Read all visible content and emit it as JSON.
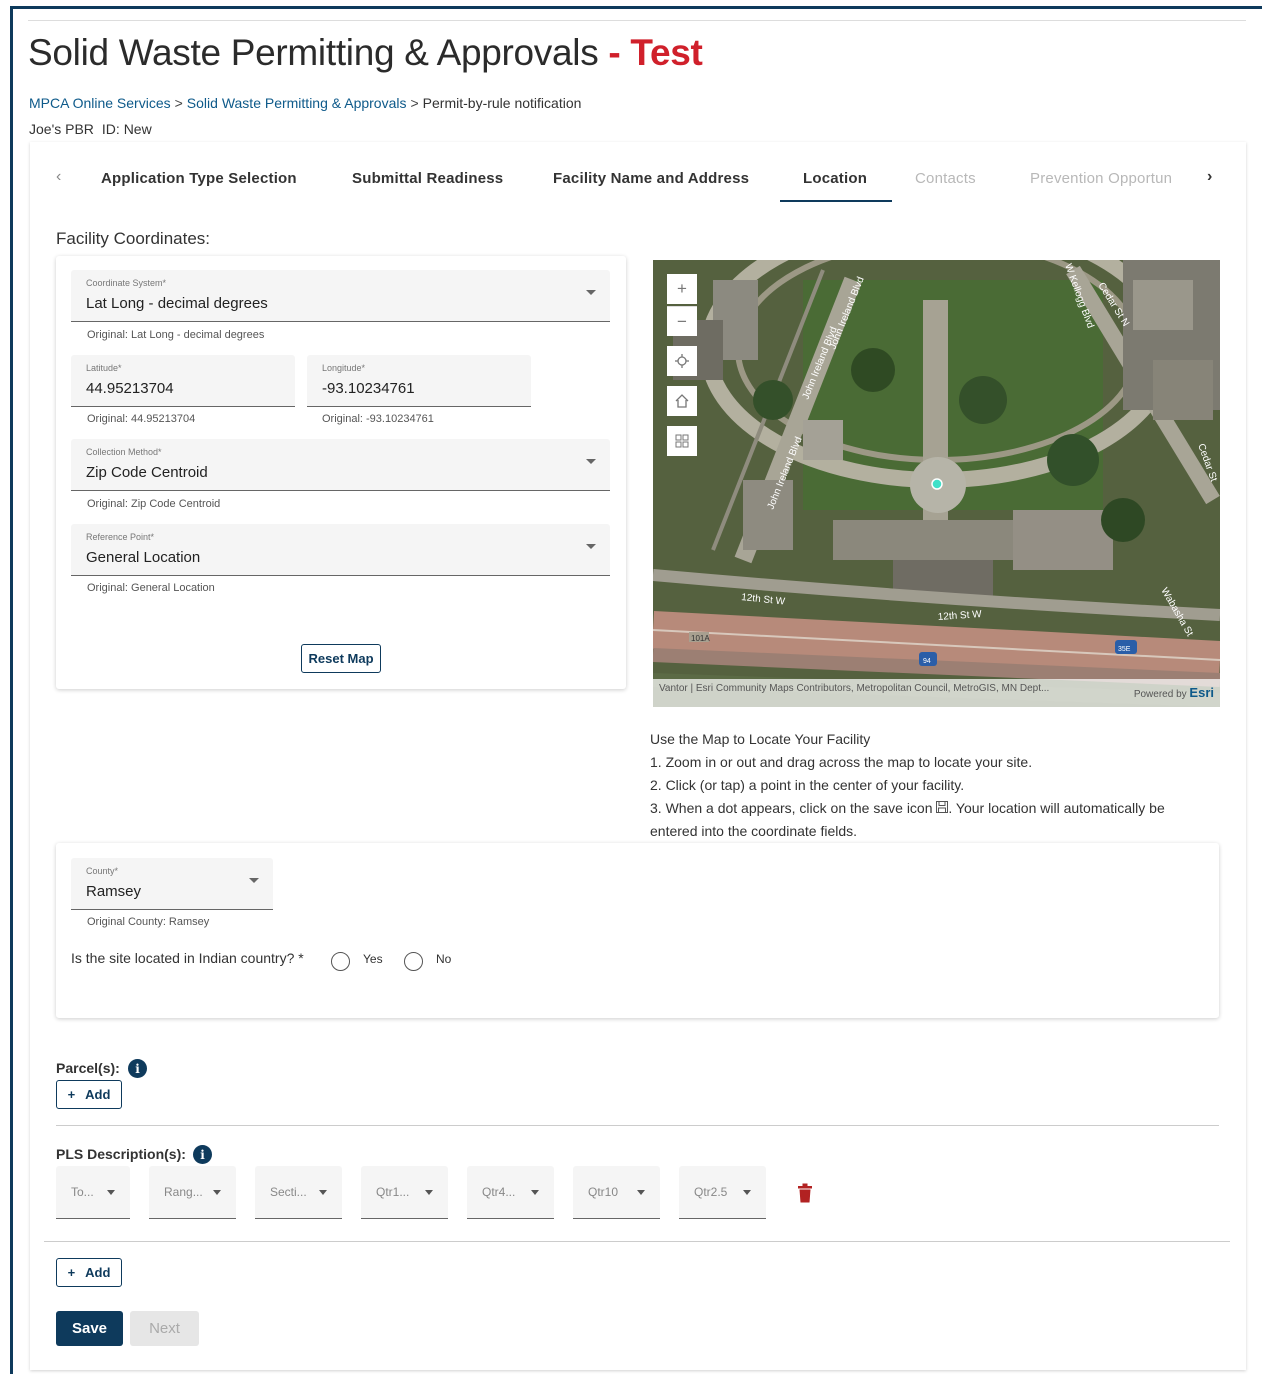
{
  "header": {
    "title": "Solid Waste Permitting & Approvals",
    "title_suffix": "- Test",
    "breadcrumb": [
      "MPCA Online Services",
      "Solid Waste Permitting & Approvals",
      "Permit-by-rule notification"
    ],
    "breadcrumb_sep": ">",
    "record_name": "Joe's PBR",
    "record_id": "ID: New"
  },
  "tabs": {
    "prev_icon": "chevron-left-icon",
    "next_icon": "chevron-right-icon",
    "items": [
      {
        "label": "Application Type Selection",
        "state": "enabled"
      },
      {
        "label": "Submittal Readiness",
        "state": "enabled"
      },
      {
        "label": "Facility Name and Address",
        "state": "enabled"
      },
      {
        "label": "Location",
        "state": "active"
      },
      {
        "label": "Contacts",
        "state": "disabled"
      },
      {
        "label": "Prevention Opportun",
        "state": "disabled"
      }
    ]
  },
  "coordinates": {
    "heading": "Facility Coordinates:",
    "coordinate_system": {
      "label": "Coordinate System*",
      "value": "Lat Long - decimal degrees",
      "original": "Original: Lat Long - decimal degrees"
    },
    "latitude": {
      "label": "Latitude*",
      "value": "44.95213704",
      "original": "Original: 44.95213704"
    },
    "longitude": {
      "label": "Longitude*",
      "value": "-93.10234761",
      "original": "Original: -93.10234761"
    },
    "collection_method": {
      "label": "Collection Method*",
      "value": "Zip Code Centroid",
      "original": "Original: Zip Code Centroid"
    },
    "reference_point": {
      "label": "Reference Point*",
      "value": "General Location",
      "original": "Original: General Location"
    },
    "reset_label": "Reset Map"
  },
  "map": {
    "controls": {
      "zoom_in": "+",
      "zoom_out": "−"
    },
    "street_labels": [
      "John Ireland Blvd",
      "John Ireland Blvd",
      "John Ireland Blvd",
      "12th St W",
      "12th St W",
      "Cedar St N",
      "Cedar St",
      "W Kellogg Blvd",
      "Wabasha St",
      "101A",
      "94",
      "35E"
    ],
    "attribution": "Vantor | Esri Community Maps Contributors, Metropolitan Council, MetroGIS, MN Dept...",
    "powered_by": "Powered by",
    "esri": "Esri",
    "colors": {
      "marker": "#3fe0c8",
      "highway": "#b78a7a"
    }
  },
  "instructions": {
    "title": "Use the Map to Locate Your Facility",
    "step1": "1. Zoom in or out and drag across the map to locate your site.",
    "step2": "2. Click (or tap) a point in the center of your facility.",
    "step3a": "3. When a dot appears, click on the save icon",
    "step3b": ". Your location will automatically be",
    "step3c": "entered into the coordinate fields."
  },
  "county": {
    "label": "County*",
    "value": "Ramsey",
    "original": "Original County: Ramsey",
    "indian_country_question": "Is the site located in Indian country? *",
    "yes": "Yes",
    "no": "No"
  },
  "parcels": {
    "label": "Parcel(s):",
    "add_label": "Add"
  },
  "pls": {
    "label": "PLS Description(s):",
    "fields": [
      "To...",
      "Rang...",
      "Secti...",
      "Qtr1...",
      "Qtr4...",
      "Qtr10",
      "Qtr2.5"
    ],
    "add_label": "Add"
  },
  "actions": {
    "save": "Save",
    "next": "Next"
  },
  "colors": {
    "brand": "#0e3a5c",
    "accent_red": "#d0202b",
    "link": "#0e5a8a",
    "delete": "#b22222"
  }
}
